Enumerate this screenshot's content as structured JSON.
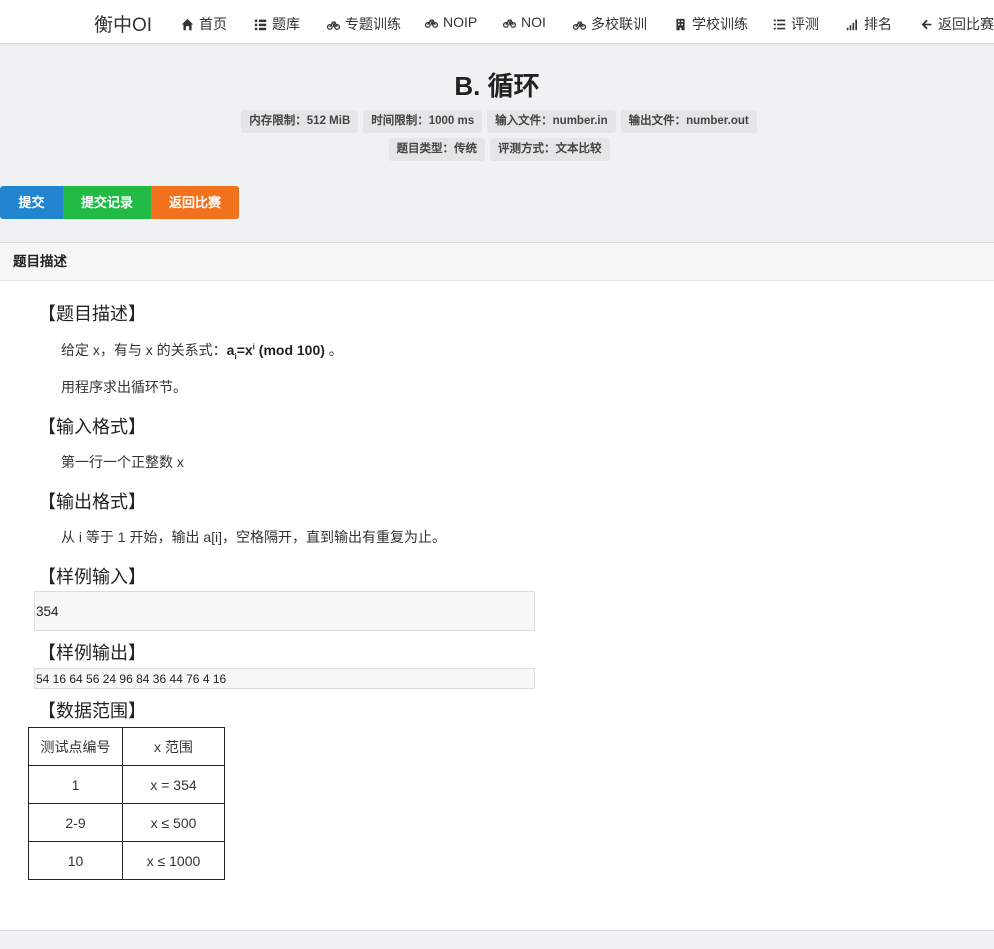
{
  "nav": {
    "brand": "衡中OI",
    "items": [
      {
        "icon": "home-icon",
        "label": "首页"
      },
      {
        "icon": "list-icon",
        "label": "题库"
      },
      {
        "icon": "bicycle-icon",
        "label": "专题训练"
      },
      {
        "icon": "bicycle-icon",
        "label": "NOIP"
      },
      {
        "icon": "bicycle-icon",
        "label": "NOI"
      },
      {
        "icon": "bicycle-icon",
        "label": "多校联训"
      },
      {
        "icon": "building-icon",
        "label": "学校训练"
      },
      {
        "icon": "ordered-list-icon",
        "label": "评测"
      },
      {
        "icon": "signal-icon",
        "label": "排名"
      },
      {
        "icon": "arrow-left-icon",
        "label": "返回比赛"
      }
    ]
  },
  "problem": {
    "title": "B. 循环",
    "meta_row1": [
      "内存限制：512 MiB",
      "时间限制：1000 ms",
      "输入文件：number.in",
      "输出文件：number.out"
    ],
    "meta_row2": [
      "题目类型：传统",
      "评测方式：文本比较"
    ]
  },
  "buttons": {
    "submit": "提交",
    "records": "提交记录",
    "back": "返回比赛"
  },
  "panel": {
    "header": "题目描述",
    "desc_title": "【题目描述】",
    "desc_text1": "给定 x，有与 x 的关系式：",
    "formula_a": "a",
    "formula_i1": "i",
    "formula_eq": "=x",
    "formula_i2": "i",
    "formula_mod": " (mod 100)",
    "desc_text2": " 。",
    "desc_line2": "用程序求出循环节。",
    "input_title": "【输入格式】",
    "input_text": "第一行一个正整数 x",
    "output_title": "【输出格式】",
    "output_text": "从 i 等于 1 开始，输出 a[i]，空格隔开，直到输出有重复为止。",
    "sample_in_title": "【样例输入】",
    "sample_in": "354",
    "sample_out_title": "【样例输出】",
    "sample_out": "54 16 64 56 24 96 84 36 44 76 4 16",
    "range_title": "【数据范围】",
    "table": {
      "headers": [
        "测试点编号",
        "x 范围"
      ],
      "rows": [
        [
          "1",
          "x = 354"
        ],
        [
          "2-9",
          "x ≤ 500"
        ],
        [
          "10",
          "x ≤ 1000"
        ]
      ]
    }
  },
  "colors": {
    "blue": "#2185d0",
    "green": "#21ba45",
    "orange": "#f2711c"
  }
}
